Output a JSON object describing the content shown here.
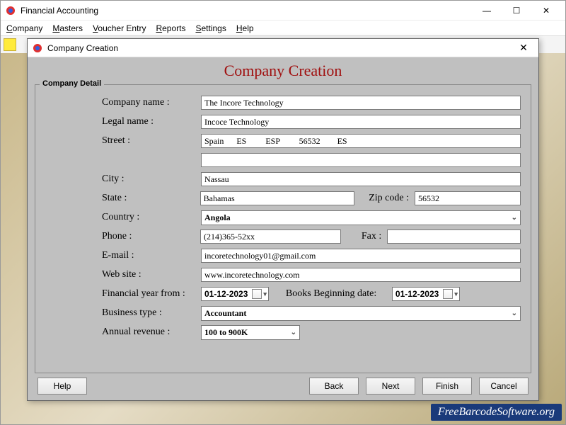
{
  "window": {
    "title": "Financial Accounting"
  },
  "menu": {
    "company": "Company",
    "masters": "Masters",
    "voucher": "Voucher Entry",
    "reports": "Reports",
    "settings": "Settings",
    "help": "Help"
  },
  "dialog": {
    "title": "Company Creation",
    "heading": "Company Creation",
    "group_title": "Company Detail"
  },
  "labels": {
    "company_name": "Company name :",
    "legal_name": "Legal name :",
    "street": "Street :",
    "city": "City :",
    "state": "State :",
    "zip": "Zip code :",
    "country": "Country :",
    "phone": "Phone :",
    "fax": "Fax :",
    "email": "E-mail :",
    "website": "Web site :",
    "fin_year": "Financial year from :",
    "books_begin": "Books Beginning date:",
    "business_type": "Business type :",
    "annual_revenue": "Annual revenue :"
  },
  "values": {
    "company_name": "The Incore Technology",
    "legal_name": "Incoce Technology",
    "street": "Spain      ES         ESP         56532        ES",
    "street2": "",
    "city": "Nassau",
    "state": "Bahamas",
    "zip": "56532",
    "country": "Angola",
    "phone": "(214)365-52xx",
    "fax": "",
    "email": "incoretechnology01@gmail.com",
    "website": "www.incoretechnology.com",
    "fin_year": "01-12-2023",
    "books_begin": "01-12-2023",
    "business_type": "Accountant",
    "annual_revenue": "100 to 900K"
  },
  "buttons": {
    "help": "Help",
    "back": "Back",
    "next": "Next",
    "finish": "Finish",
    "cancel": "Cancel"
  },
  "watermark": "FreeBarcodeSoftware.org"
}
